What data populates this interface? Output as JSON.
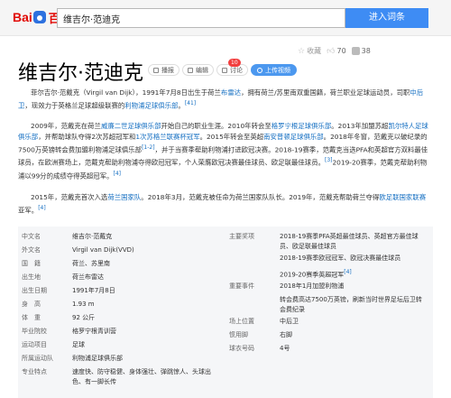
{
  "header": {
    "logo": {
      "bai": "Bai",
      "du": "du",
      "baike": "百科"
    },
    "search_value": "维吉尔·范迪克",
    "search_button": "进入词条"
  },
  "top_actions": {
    "favorite": "收藏",
    "like_count": "70",
    "share_count": "38"
  },
  "title": "维吉尔·范迪克",
  "tools": {
    "play": "播报",
    "edit": "编辑",
    "discuss": "讨论",
    "discuss_badge": "10",
    "upload": "上传视频"
  },
  "paragraphs": {
    "p1_a": "菲尔吉尔·范戴克（Virgil van Dijk），1991年7月8日出生于荷兰",
    "p1_link1": "布雷达",
    "p1_b": "，拥有荷兰/苏里南双重国籍，荷兰职业足球运动员，司职",
    "p1_link2": "中后卫",
    "p1_c": "，现效力于英格兰足球超级联赛的",
    "p1_link3": "利物浦足球俱乐部",
    "p1_d": "。",
    "p1_sup": "[41]",
    "p2_a": "2009年，范戴克在荷兰",
    "p2_link1": "威廉二世足球俱乐部",
    "p2_b": "开始自己的职业生涯。2010年转会至",
    "p2_link2": "格罗宁根足球俱乐部",
    "p2_c": "。2013年加盟苏超",
    "p2_link3": "凯尔特人足球俱乐部",
    "p2_d": "，并帮助球队夺得2次苏超冠军和",
    "p2_link4": "1次苏格兰联赛杯冠军",
    "p2_e": "。2015年转会至英超",
    "p2_link5": "南安普顿足球俱乐部",
    "p2_f": "。2018年冬窗，范戴克以破纪录的7500万英镑转会费加盟利物浦足球俱乐部",
    "p2_sup1": "[1-2]",
    "p2_g": "，并于当赛季帮助利物浦打进欧冠决赛。2018-19赛季，范戴克当选PFA和英超官方双料最佳球员，在欧洲赛场上，范戴克帮助利物浦夺得欧冠冠军，个人荣膺欧冠决赛最佳球员、欧足联最佳球员。",
    "p2_sup2": "[3]",
    "p2_h": "2019-20赛季，范戴克帮助利物浦以99分的成绩夺得英超冠军。",
    "p2_sup3": "[4]",
    "p3_a": "2015年，范戴克首次入选",
    "p3_link1": "荷兰国家队",
    "p3_b": "。2018年3月，范戴克被任命为荷兰国家队队长。2019年，范戴克帮助荷兰夺得",
    "p3_link2": "欧足联国家联赛",
    "p3_c": "亚军。",
    "p3_sup": "[4]"
  },
  "info_left": [
    {
      "k": "中文名",
      "v": "维吉尔·范戴克"
    },
    {
      "k": "外文名",
      "v": "Virgil van Dijk(VVD)"
    },
    {
      "k": "国　籍",
      "v": "荷兰、苏里南",
      "link": true
    },
    {
      "k": "出生地",
      "v": "荷兰布雷达"
    },
    {
      "k": "出生日期",
      "v": "1991年7月8日"
    },
    {
      "k": "身　高",
      "v": "1.93 m"
    },
    {
      "k": "体　重",
      "v": "92 公斤"
    },
    {
      "k": "毕业院校",
      "v": "格罗宁根青训营"
    },
    {
      "k": "运动项目",
      "v": "足球",
      "link": true
    },
    {
      "k": "所属运动队",
      "v": "利物浦足球俱乐部"
    },
    {
      "k": "专业特点",
      "v": "速度快、防守稳健、身体强壮、弹跳惊人、头球出色、有一脚长传"
    }
  ],
  "info_right": [
    {
      "k": "主要奖项",
      "v": "2018-19赛季PFA英超最佳球员、英超官方最佳球员、欧足联最佳球员"
    },
    {
      "k": "",
      "v": "2018-19赛季欧冠冠军、欧冠决赛最佳球员"
    },
    {
      "k": "",
      "v": "2019-20赛季英超冠军",
      "sup": "[4]"
    },
    {
      "k": "重要事件",
      "v": "2018年1月加盟利物浦"
    },
    {
      "k": "",
      "v": "转会费高达7500万英镑，刷新当时世界足坛后卫转会费纪录"
    },
    {
      "k": "场上位置",
      "v": "中后卫"
    },
    {
      "k": "惯用脚",
      "v": "右脚"
    },
    {
      "k": "球衣号码",
      "v": "4号"
    }
  ]
}
